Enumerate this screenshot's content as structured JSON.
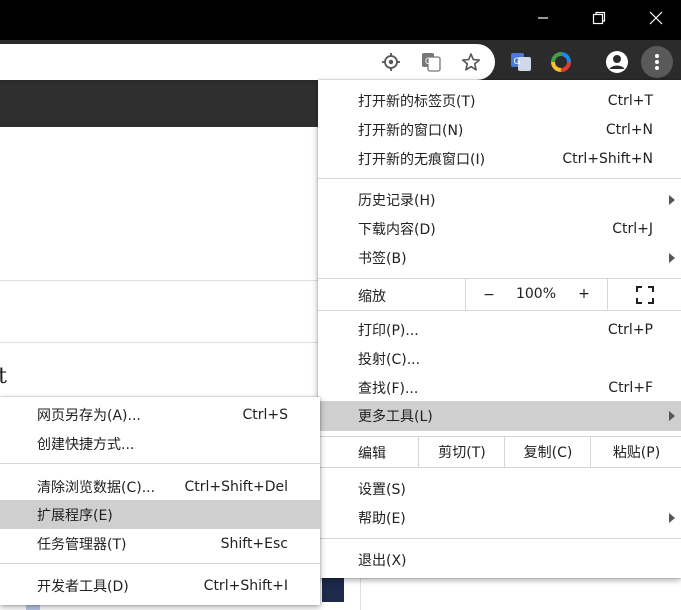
{
  "menu": {
    "new_tab": {
      "label": "打开新的标签页(T)",
      "shortcut": "Ctrl+T"
    },
    "new_window": {
      "label": "打开新的窗口(N)",
      "shortcut": "Ctrl+N"
    },
    "incognito": {
      "label": "打开新的无痕窗口(I)",
      "shortcut": "Ctrl+Shift+N"
    },
    "history": {
      "label": "历史记录(H)"
    },
    "downloads": {
      "label": "下载内容(D)",
      "shortcut": "Ctrl+J"
    },
    "bookmarks": {
      "label": "书签(B)"
    },
    "zoom": {
      "label": "缩放",
      "minus": "−",
      "value": "100%",
      "plus": "+"
    },
    "print": {
      "label": "打印(P)...",
      "shortcut": "Ctrl+P"
    },
    "cast": {
      "label": "投射(C)..."
    },
    "find": {
      "label": "查找(F)...",
      "shortcut": "Ctrl+F"
    },
    "more_tools": {
      "label": "更多工具(L)"
    },
    "edit": {
      "label": "编辑",
      "cut": "剪切(T)",
      "copy": "复制(C)",
      "paste": "粘贴(P)"
    },
    "settings": {
      "label": "设置(S)"
    },
    "help": {
      "label": "帮助(E)"
    },
    "exit": {
      "label": "退出(X)"
    }
  },
  "submenu": {
    "save_page": {
      "label": "网页另存为(A)...",
      "shortcut": "Ctrl+S"
    },
    "create_shortcut": {
      "label": "创建快捷方式..."
    },
    "clear_data": {
      "label": "清除浏览数据(C)...",
      "shortcut": "Ctrl+Shift+Del"
    },
    "extensions": {
      "label": "扩展程序(E)"
    },
    "task_manager": {
      "label": "任务管理器(T)",
      "shortcut": "Shift+Esc"
    },
    "dev_tools": {
      "label": "开发者工具(D)",
      "shortcut": "Ctrl+Shift+I"
    }
  },
  "page": {
    "partial_text": "t"
  },
  "colors": {
    "highlight": "#cfcfcf",
    "titlebar": "#000000",
    "toolbar": "#2b2b2b"
  }
}
